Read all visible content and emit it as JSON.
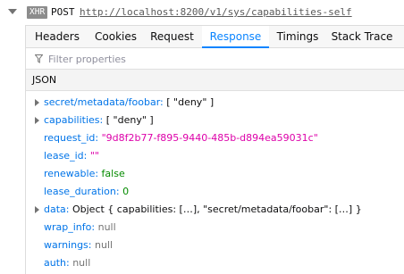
{
  "request": {
    "badge": "XHR",
    "method": "POST",
    "url": "http://localhost:8200/v1/sys/capabilities-self"
  },
  "tabs": [
    {
      "label": "Headers",
      "active": false
    },
    {
      "label": "Cookies",
      "active": false
    },
    {
      "label": "Request",
      "active": false
    },
    {
      "label": "Response",
      "active": true
    },
    {
      "label": "Timings",
      "active": false
    },
    {
      "label": "Stack Trace",
      "active": false
    }
  ],
  "filter": {
    "placeholder": "Filter properties",
    "icon": "funnel-icon"
  },
  "section": {
    "title": "JSON"
  },
  "tree": [
    {
      "expandable": true,
      "key": "secret/metadata/foobar:",
      "value": "[ \"deny\" ]",
      "value_type": "array"
    },
    {
      "expandable": true,
      "key": "capabilities:",
      "value": "[ \"deny\" ]",
      "value_type": "array"
    },
    {
      "expandable": false,
      "key": "request_id:",
      "value": "\"9d8f2b77-f895-9440-485b-d894ea59031c\"",
      "value_type": "string"
    },
    {
      "expandable": false,
      "key": "lease_id:",
      "value": "\"\"",
      "value_type": "string"
    },
    {
      "expandable": false,
      "key": "renewable:",
      "value": "false",
      "value_type": "bool"
    },
    {
      "expandable": false,
      "key": "lease_duration:",
      "value": "0",
      "value_type": "number"
    },
    {
      "expandable": true,
      "key": "data:",
      "value": "Object { capabilities: […], \"secret/metadata/foobar\": […] }",
      "value_type": "object"
    },
    {
      "expandable": false,
      "key": "wrap_info:",
      "value": "null",
      "value_type": "null"
    },
    {
      "expandable": false,
      "key": "warnings:",
      "value": "null",
      "value_type": "null"
    },
    {
      "expandable": false,
      "key": "auth:",
      "value": "null",
      "value_type": "null"
    }
  ],
  "colors": {
    "accent": "#0a84ff",
    "key": "#0074e8",
    "string": "#dd00a9",
    "bool_number": "#058b00",
    "null": "#737373"
  }
}
